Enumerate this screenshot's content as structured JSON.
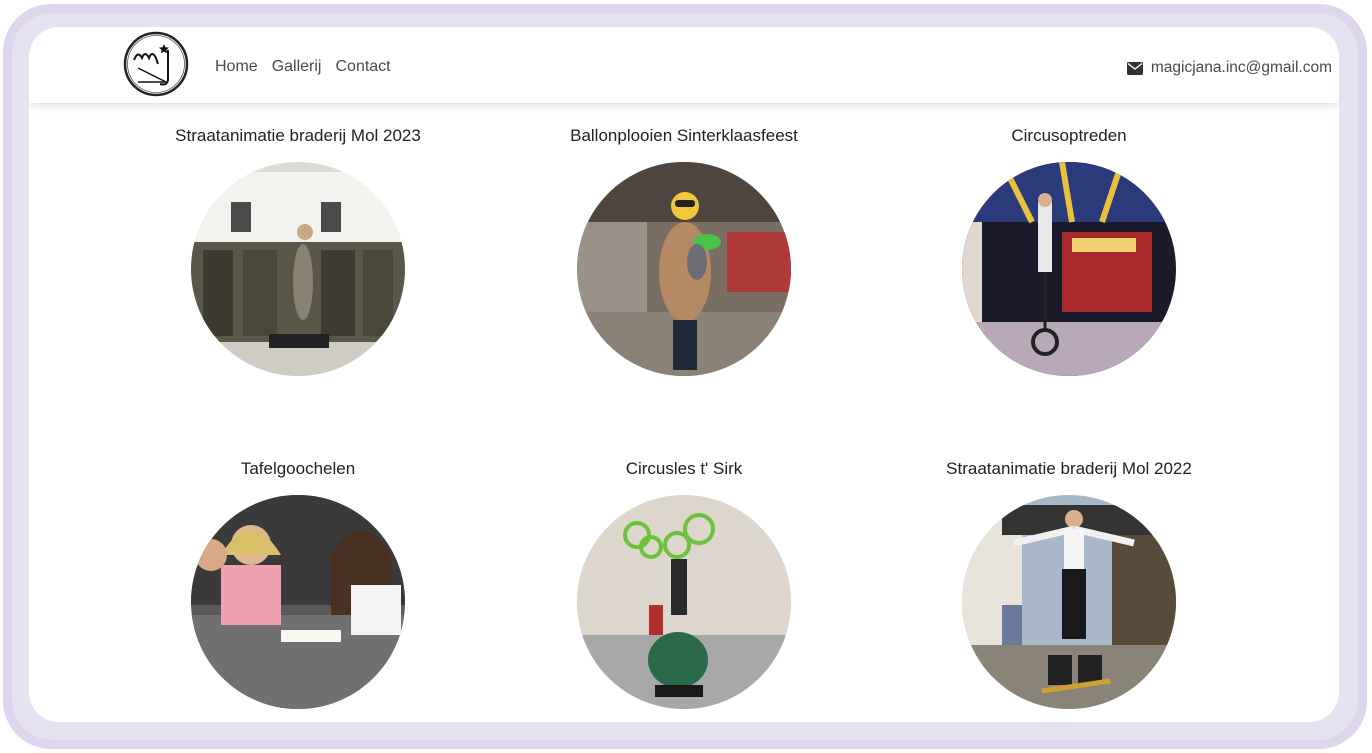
{
  "nav": {
    "logo_text": "mj",
    "links": [
      "Home",
      "Gallerij",
      "Contact"
    ],
    "email": "magicjana.inc@gmail.com",
    "email_icon": "envelope-icon"
  },
  "gallery": [
    {
      "title": "Straatanimatie braderij Mol 2023"
    },
    {
      "title": "Ballonplooien Sinterklaasfeest"
    },
    {
      "title": "Circusoptreden"
    },
    {
      "title": "Tafelgoochelen"
    },
    {
      "title": "Circusles t' Sirk"
    },
    {
      "title": "Straatanimatie braderij Mol 2022"
    }
  ]
}
